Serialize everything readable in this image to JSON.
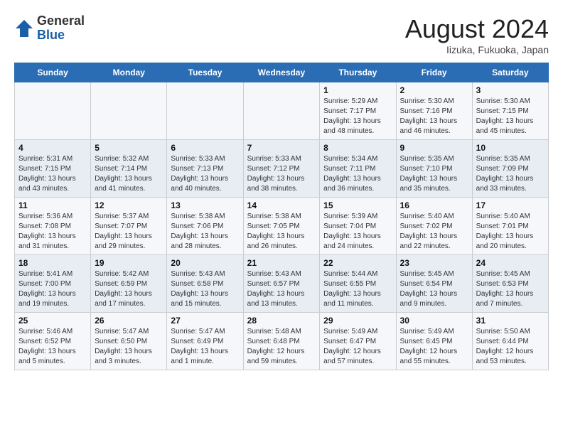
{
  "header": {
    "logo_line1": "General",
    "logo_line2": "Blue",
    "main_title": "August 2024",
    "subtitle": "Iizuka, Fukuoka, Japan"
  },
  "days_of_week": [
    "Sunday",
    "Monday",
    "Tuesday",
    "Wednesday",
    "Thursday",
    "Friday",
    "Saturday"
  ],
  "weeks": [
    [
      {
        "day": "",
        "detail": ""
      },
      {
        "day": "",
        "detail": ""
      },
      {
        "day": "",
        "detail": ""
      },
      {
        "day": "",
        "detail": ""
      },
      {
        "day": "1",
        "detail": "Sunrise: 5:29 AM\nSunset: 7:17 PM\nDaylight: 13 hours\nand 48 minutes."
      },
      {
        "day": "2",
        "detail": "Sunrise: 5:30 AM\nSunset: 7:16 PM\nDaylight: 13 hours\nand 46 minutes."
      },
      {
        "day": "3",
        "detail": "Sunrise: 5:30 AM\nSunset: 7:15 PM\nDaylight: 13 hours\nand 45 minutes."
      }
    ],
    [
      {
        "day": "4",
        "detail": "Sunrise: 5:31 AM\nSunset: 7:15 PM\nDaylight: 13 hours\nand 43 minutes."
      },
      {
        "day": "5",
        "detail": "Sunrise: 5:32 AM\nSunset: 7:14 PM\nDaylight: 13 hours\nand 41 minutes."
      },
      {
        "day": "6",
        "detail": "Sunrise: 5:33 AM\nSunset: 7:13 PM\nDaylight: 13 hours\nand 40 minutes."
      },
      {
        "day": "7",
        "detail": "Sunrise: 5:33 AM\nSunset: 7:12 PM\nDaylight: 13 hours\nand 38 minutes."
      },
      {
        "day": "8",
        "detail": "Sunrise: 5:34 AM\nSunset: 7:11 PM\nDaylight: 13 hours\nand 36 minutes."
      },
      {
        "day": "9",
        "detail": "Sunrise: 5:35 AM\nSunset: 7:10 PM\nDaylight: 13 hours\nand 35 minutes."
      },
      {
        "day": "10",
        "detail": "Sunrise: 5:35 AM\nSunset: 7:09 PM\nDaylight: 13 hours\nand 33 minutes."
      }
    ],
    [
      {
        "day": "11",
        "detail": "Sunrise: 5:36 AM\nSunset: 7:08 PM\nDaylight: 13 hours\nand 31 minutes."
      },
      {
        "day": "12",
        "detail": "Sunrise: 5:37 AM\nSunset: 7:07 PM\nDaylight: 13 hours\nand 29 minutes."
      },
      {
        "day": "13",
        "detail": "Sunrise: 5:38 AM\nSunset: 7:06 PM\nDaylight: 13 hours\nand 28 minutes."
      },
      {
        "day": "14",
        "detail": "Sunrise: 5:38 AM\nSunset: 7:05 PM\nDaylight: 13 hours\nand 26 minutes."
      },
      {
        "day": "15",
        "detail": "Sunrise: 5:39 AM\nSunset: 7:04 PM\nDaylight: 13 hours\nand 24 minutes."
      },
      {
        "day": "16",
        "detail": "Sunrise: 5:40 AM\nSunset: 7:02 PM\nDaylight: 13 hours\nand 22 minutes."
      },
      {
        "day": "17",
        "detail": "Sunrise: 5:40 AM\nSunset: 7:01 PM\nDaylight: 13 hours\nand 20 minutes."
      }
    ],
    [
      {
        "day": "18",
        "detail": "Sunrise: 5:41 AM\nSunset: 7:00 PM\nDaylight: 13 hours\nand 19 minutes."
      },
      {
        "day": "19",
        "detail": "Sunrise: 5:42 AM\nSunset: 6:59 PM\nDaylight: 13 hours\nand 17 minutes."
      },
      {
        "day": "20",
        "detail": "Sunrise: 5:43 AM\nSunset: 6:58 PM\nDaylight: 13 hours\nand 15 minutes."
      },
      {
        "day": "21",
        "detail": "Sunrise: 5:43 AM\nSunset: 6:57 PM\nDaylight: 13 hours\nand 13 minutes."
      },
      {
        "day": "22",
        "detail": "Sunrise: 5:44 AM\nSunset: 6:55 PM\nDaylight: 13 hours\nand 11 minutes."
      },
      {
        "day": "23",
        "detail": "Sunrise: 5:45 AM\nSunset: 6:54 PM\nDaylight: 13 hours\nand 9 minutes."
      },
      {
        "day": "24",
        "detail": "Sunrise: 5:45 AM\nSunset: 6:53 PM\nDaylight: 13 hours\nand 7 minutes."
      }
    ],
    [
      {
        "day": "25",
        "detail": "Sunrise: 5:46 AM\nSunset: 6:52 PM\nDaylight: 13 hours\nand 5 minutes."
      },
      {
        "day": "26",
        "detail": "Sunrise: 5:47 AM\nSunset: 6:50 PM\nDaylight: 13 hours\nand 3 minutes."
      },
      {
        "day": "27",
        "detail": "Sunrise: 5:47 AM\nSunset: 6:49 PM\nDaylight: 13 hours\nand 1 minute."
      },
      {
        "day": "28",
        "detail": "Sunrise: 5:48 AM\nSunset: 6:48 PM\nDaylight: 12 hours\nand 59 minutes."
      },
      {
        "day": "29",
        "detail": "Sunrise: 5:49 AM\nSunset: 6:47 PM\nDaylight: 12 hours\nand 57 minutes."
      },
      {
        "day": "30",
        "detail": "Sunrise: 5:49 AM\nSunset: 6:45 PM\nDaylight: 12 hours\nand 55 minutes."
      },
      {
        "day": "31",
        "detail": "Sunrise: 5:50 AM\nSunset: 6:44 PM\nDaylight: 12 hours\nand 53 minutes."
      }
    ]
  ]
}
